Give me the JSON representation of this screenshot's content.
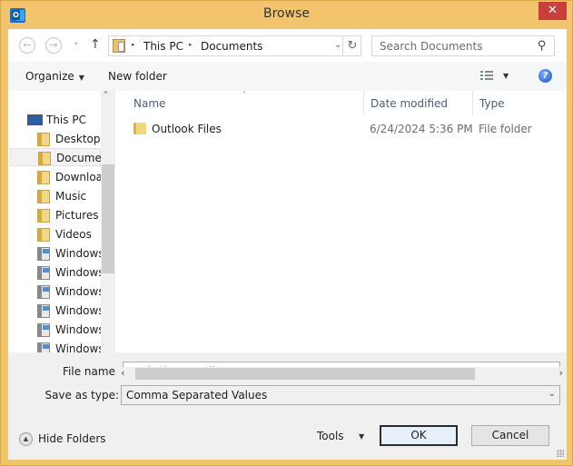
{
  "window": {
    "title": "Browse",
    "close_label": "✕"
  },
  "navbar": {
    "back_icon": "←",
    "forward_icon": "→",
    "recent_icon": "▾",
    "up_icon": "↑",
    "breadcrumb": [
      "This PC",
      "Documents"
    ],
    "crumb_sep": "▸",
    "address_dropdown": "⌄",
    "refresh_icon": "↻",
    "search_placeholder": "Search Documents",
    "search_icon": "⚲"
  },
  "commandbar": {
    "organize": "Organize",
    "organize_caret": "▼",
    "new_folder": "New folder",
    "view_caret": "▼",
    "help_icon": "?"
  },
  "navpane": {
    "up_arrow": "˄",
    "down_arrow": "˅",
    "items": [
      {
        "label": "This PC",
        "icon": "computer-icon"
      },
      {
        "label": "Desktop",
        "icon": "desktop-folder-icon"
      },
      {
        "label": "Documents",
        "icon": "documents-folder-icon",
        "selected": true
      },
      {
        "label": "Downloads",
        "icon": "downloads-folder-icon"
      },
      {
        "label": "Music",
        "icon": "music-folder-icon"
      },
      {
        "label": "Pictures",
        "icon": "pictures-folder-icon"
      },
      {
        "label": "Videos",
        "icon": "videos-folder-icon"
      },
      {
        "label": "Windows",
        "icon": "network-drive-icon"
      },
      {
        "label": "Windows",
        "icon": "network-drive-icon"
      },
      {
        "label": "Windows",
        "icon": "network-drive-icon"
      },
      {
        "label": "Windows",
        "icon": "network-drive-icon"
      },
      {
        "label": "Windows",
        "icon": "network-drive-icon"
      },
      {
        "label": "Windows",
        "icon": "network-drive-icon"
      }
    ]
  },
  "filelist": {
    "columns": [
      "Name",
      "Date modified",
      "Type"
    ],
    "sort_indicator": "˄",
    "rows": [
      {
        "name": "Outlook Files",
        "date": "6/24/2024 5:36 PM",
        "type": "File folder"
      }
    ],
    "scroll_left": "‹",
    "scroll_right": "›"
  },
  "form": {
    "file_name_label": "File name:",
    "file_name_value": "Outlook Data Files",
    "save_type_label": "Save as type:",
    "save_type_value": "Comma Separated Values",
    "dropdown_icon": "⌄"
  },
  "footer": {
    "hide_folders": "Hide Folders",
    "hide_folders_icon": "▲",
    "tools": "Tools",
    "tools_caret": "▼",
    "ok": "OK",
    "cancel": "Cancel"
  }
}
